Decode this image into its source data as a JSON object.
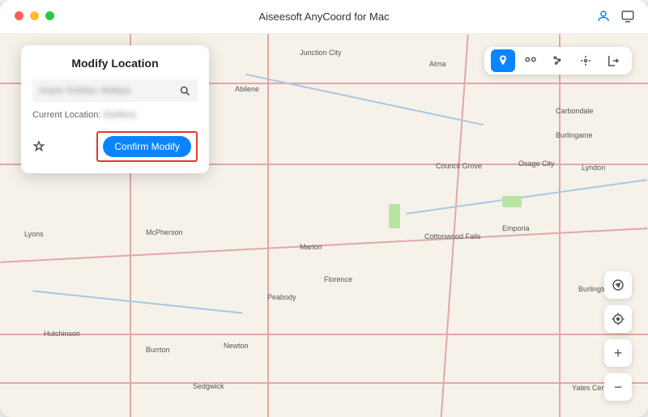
{
  "app": {
    "title": "Aiseesoft AnyCoord for Mac"
  },
  "panel": {
    "heading": "Modify Location",
    "search_value": "Anyan Sulidan, Malaya",
    "current_label": "Current Location:",
    "current_value": "(hidden)",
    "confirm_label": "Confirm Modify"
  },
  "map": {
    "cities": [
      "Junction City",
      "Alma",
      "Abilene",
      "Carbondale",
      "Burlingame",
      "Osage City",
      "Lyndon",
      "Council Grove",
      "McPherson",
      "Lyons",
      "Marion",
      "Cottonwood Falls",
      "Emporia",
      "Florence",
      "Peabody",
      "Burlington",
      "Hutchinson",
      "Burrton",
      "Newton",
      "Sedgwick",
      "Yates Center"
    ]
  },
  "colors": {
    "accent": "#0a84ff",
    "highlight_border": "#e13b2a"
  }
}
